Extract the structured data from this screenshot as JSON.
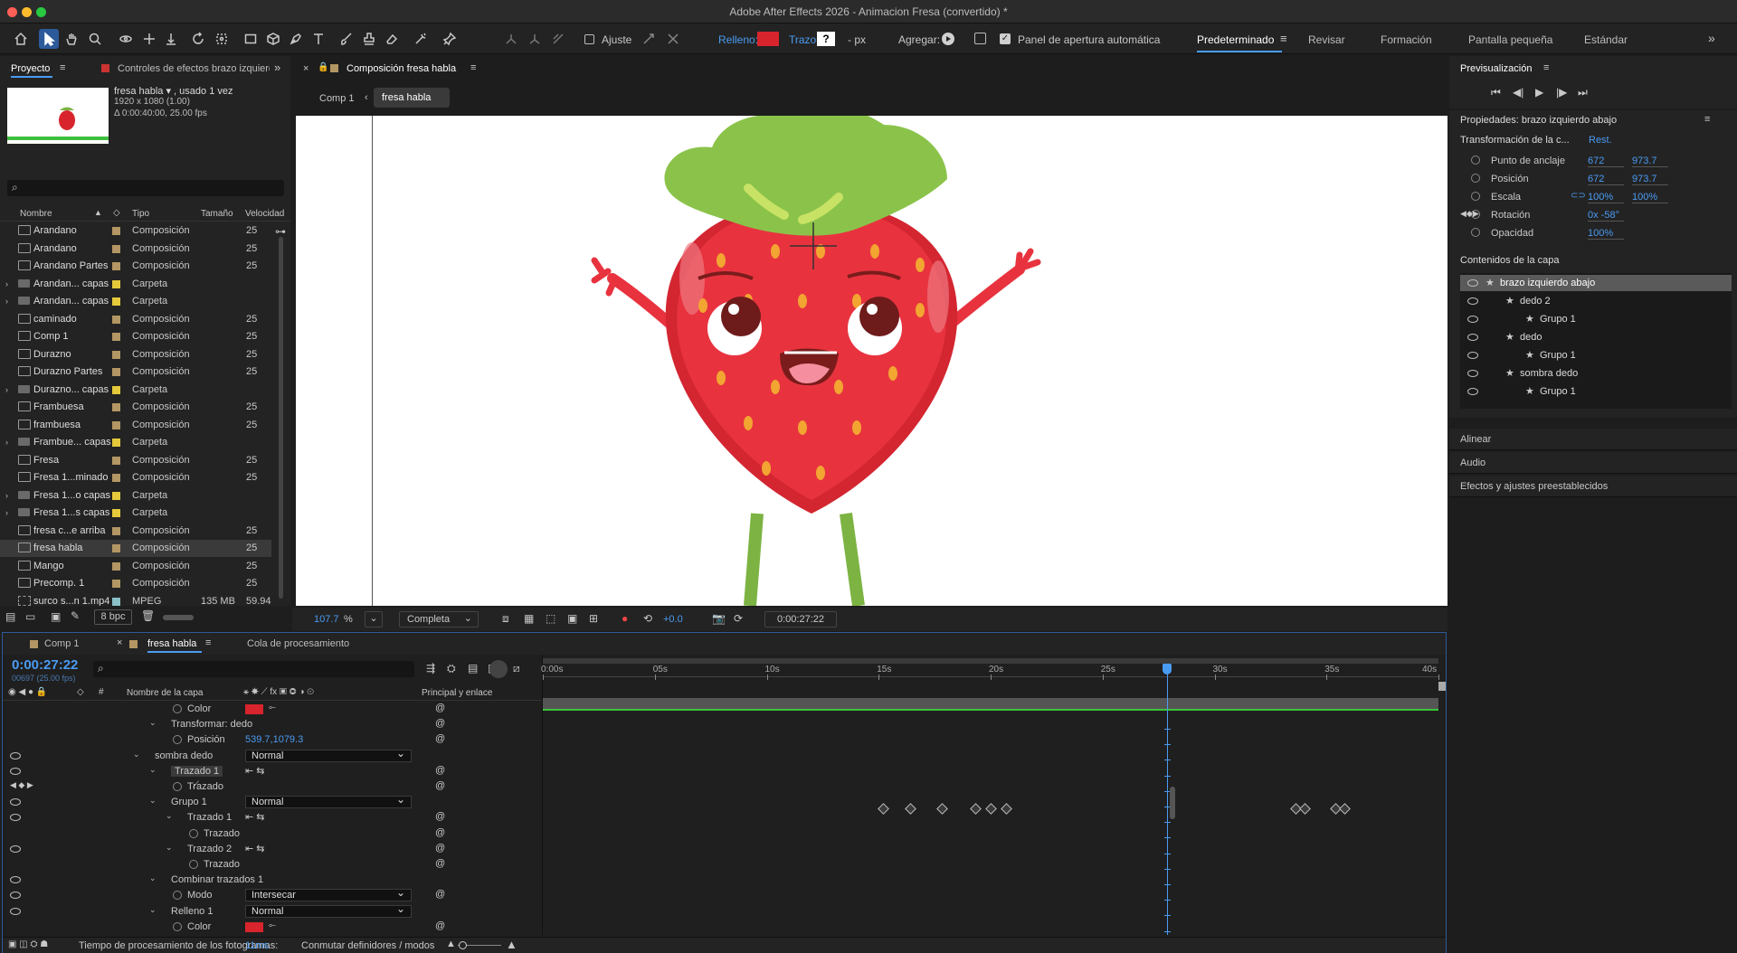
{
  "titlebar": {
    "title": "Adobe After Effects 2026 - Animacion Fresa (convertido) *"
  },
  "toolbar": {
    "snap_label": "Ajuste",
    "fill_label": "Relleno:",
    "stroke_label": "Trazo:",
    "stroke_value": "?",
    "stroke_units": "- px",
    "add_label": "Agregar:",
    "auto_open_label": "Panel de apertura automática",
    "fill_color": "#d8242c",
    "workspaces": [
      "Predeterminado",
      "Revisar",
      "Formación",
      "Pantalla pequeña",
      "Estándar"
    ]
  },
  "project": {
    "tab_label": "Proyecto",
    "effects_tab_label": "Controles de efectos brazo izquierdo",
    "item_name": "fresa habla ▾ , usado 1 vez",
    "item_dims": "1920 x 1080 (1.00)",
    "item_duration": "Δ 0:00:40:00, 25.00 fps",
    "columns": {
      "name": "Nombre",
      "type": "Tipo",
      "size": "Tamaño",
      "speed": "Velocidad"
    },
    "items": [
      {
        "name": "Arandano",
        "type": "Composición",
        "size": "",
        "speed": "25",
        "kind": "comp"
      },
      {
        "name": "Arandano",
        "type": "Composición",
        "size": "",
        "speed": "25",
        "kind": "comp"
      },
      {
        "name": "Arandano Partes",
        "type": "Composición",
        "size": "",
        "speed": "25",
        "kind": "comp"
      },
      {
        "name": "Arandan... capas",
        "type": "Carpeta",
        "size": "",
        "speed": "",
        "kind": "folder"
      },
      {
        "name": "Arandan... capas",
        "type": "Carpeta",
        "size": "",
        "speed": "",
        "kind": "folder"
      },
      {
        "name": "caminado",
        "type": "Composición",
        "size": "",
        "speed": "25",
        "kind": "comp"
      },
      {
        "name": "Comp 1",
        "type": "Composición",
        "size": "",
        "speed": "25",
        "kind": "comp"
      },
      {
        "name": "Durazno",
        "type": "Composición",
        "size": "",
        "speed": "25",
        "kind": "comp"
      },
      {
        "name": "Durazno Partes",
        "type": "Composición",
        "size": "",
        "speed": "25",
        "kind": "comp"
      },
      {
        "name": "Durazno... capas",
        "type": "Carpeta",
        "size": "",
        "speed": "",
        "kind": "folder"
      },
      {
        "name": "Frambuesa",
        "type": "Composición",
        "size": "",
        "speed": "25",
        "kind": "comp"
      },
      {
        "name": "frambuesa",
        "type": "Composición",
        "size": "",
        "speed": "25",
        "kind": "comp"
      },
      {
        "name": "Frambue... capas",
        "type": "Carpeta",
        "size": "",
        "speed": "",
        "kind": "folder"
      },
      {
        "name": "Fresa",
        "type": "Composición",
        "size": "",
        "speed": "25",
        "kind": "comp"
      },
      {
        "name": "Fresa 1...minado",
        "type": "Composición",
        "size": "",
        "speed": "25",
        "kind": "comp"
      },
      {
        "name": "Fresa 1...o capas",
        "type": "Carpeta",
        "size": "",
        "speed": "",
        "kind": "folder"
      },
      {
        "name": "Fresa 1...s capas",
        "type": "Carpeta",
        "size": "",
        "speed": "",
        "kind": "folder"
      },
      {
        "name": "fresa c...e arriba",
        "type": "Composición",
        "size": "",
        "speed": "25",
        "kind": "comp"
      },
      {
        "name": "fresa habla",
        "type": "Composición",
        "size": "",
        "speed": "25",
        "kind": "comp"
      },
      {
        "name": "Mango",
        "type": "Composición",
        "size": "",
        "speed": "25",
        "kind": "comp"
      },
      {
        "name": "Precomp. 1",
        "type": "Composición",
        "size": "",
        "speed": "25",
        "kind": "comp"
      },
      {
        "name": "surco s...n 1.mp4",
        "type": "MPEG",
        "size": "135 MB",
        "speed": "59.94",
        "kind": "file"
      }
    ],
    "bpc": "8 bpc"
  },
  "comp": {
    "tab_label": "Composición fresa habla",
    "breadcrumbs": [
      "Comp 1",
      "fresa habla"
    ],
    "zoom": "107.7",
    "zoom_unit": "%",
    "resolution": "Completa",
    "exposure": "+0.0",
    "timecode": "0:00:27:22"
  },
  "preview": {
    "title": "Previsualización"
  },
  "properties": {
    "title": "Propiedades: brazo izquierdo abajo",
    "section": "Transformación de la c...",
    "reset": "Rest.",
    "rows": [
      {
        "label": "Punto de anclaje",
        "v1": "672",
        "v2": "973.7"
      },
      {
        "label": "Posición",
        "v1": "672",
        "v2": "973.7"
      },
      {
        "label": "Escala",
        "v1": "100%",
        "v2": "100%"
      },
      {
        "label": "Rotación",
        "v1": "0x -58°",
        "v2": ""
      },
      {
        "label": "Opacidad",
        "v1": "100%",
        "v2": ""
      }
    ],
    "contents_title": "Contenidos de la capa",
    "contents": [
      {
        "label": "brazo izquierdo abajo",
        "indent": 0
      },
      {
        "label": "dedo 2",
        "indent": 1
      },
      {
        "label": "Grupo 1",
        "indent": 2
      },
      {
        "label": "dedo",
        "indent": 1
      },
      {
        "label": "Grupo 1",
        "indent": 2
      },
      {
        "label": "sombra dedo",
        "indent": 1
      },
      {
        "label": "Grupo 1",
        "indent": 2
      }
    ],
    "sections": [
      "Alinear",
      "Audio",
      "Efectos y ajustes preestablecidos"
    ]
  },
  "timeline": {
    "tabs": [
      "Comp 1",
      "fresa habla",
      "Cola de procesamiento"
    ],
    "timecode": "0:00:27:22",
    "frame_info": "00697 (25.00 fps)",
    "col_layer": "Nombre de la capa",
    "col_parent": "Principal y enlace",
    "ruler": [
      "0:00s",
      "05s",
      "10s",
      "15s",
      "20s",
      "25s",
      "30s",
      "35s",
      "40s"
    ],
    "playhead_seconds": 27.88,
    "duration_seconds": 40,
    "rows": [
      {
        "label": "Color",
        "indent": 3,
        "ctrl": "swatch",
        "value": ""
      },
      {
        "label": "Transformar: dedo",
        "indent": 2,
        "ctrl": "",
        "value": ""
      },
      {
        "label": "Posición",
        "indent": 3,
        "ctrl": "value",
        "value": "539.7,1079.3"
      },
      {
        "label": "sombra dedo",
        "indent": 1,
        "ctrl": "dropdown",
        "value": "Normal"
      },
      {
        "label": "Trazado 1",
        "indent": 2,
        "ctrl": "icons",
        "value": ""
      },
      {
        "label": "Trazado",
        "indent": 3,
        "ctrl": "",
        "value": ""
      },
      {
        "label": "Grupo 1",
        "indent": 2,
        "ctrl": "dropdown",
        "value": "Normal"
      },
      {
        "label": "Trazado 1",
        "indent": 3,
        "ctrl": "icons",
        "value": ""
      },
      {
        "label": "Trazado",
        "indent": 4,
        "ctrl": "",
        "value": ""
      },
      {
        "label": "Trazado 2",
        "indent": 3,
        "ctrl": "icons",
        "value": ""
      },
      {
        "label": "Trazado",
        "indent": 4,
        "ctrl": "",
        "value": ""
      },
      {
        "label": "Combinar trazados 1",
        "indent": 2,
        "ctrl": "",
        "value": ""
      },
      {
        "label": "Modo",
        "indent": 3,
        "ctrl": "dropdown",
        "value": "Intersecar"
      },
      {
        "label": "Relleno 1",
        "indent": 2,
        "ctrl": "dropdown",
        "value": "Normal"
      },
      {
        "label": "Color",
        "indent": 3,
        "ctrl": "swatch",
        "value": ""
      }
    ],
    "keyframe_seconds": [
      15.2,
      16.4,
      17.8,
      19.3,
      20.0,
      20.7,
      33.6,
      34.0,
      35.4,
      35.8
    ],
    "footer_label": "Tiempo de procesamiento de los fotogramas:",
    "footer_value": "11ms",
    "footer_toggle": "Conmutar definidores / modos"
  }
}
